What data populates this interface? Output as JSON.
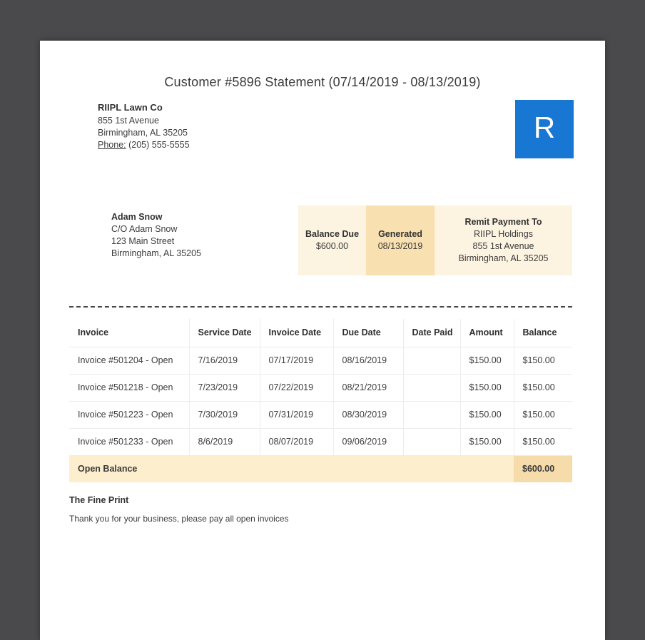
{
  "statement": {
    "title": "Customer #5896 Statement (07/14/2019 - 08/13/2019)"
  },
  "company": {
    "name": "RIIPL Lawn Co",
    "address_line1": "855 1st Avenue",
    "address_line2": "Birmingham, AL 35205",
    "phone_label": "Phone:",
    "phone": "(205) 555-5555",
    "logo_letter": "R"
  },
  "customer": {
    "name": "Adam Snow",
    "care_of": "C/O Adam Snow",
    "address_line1": "123 Main Street",
    "address_line2": "Birmingham, AL 35205"
  },
  "summary": {
    "balance_due_label": "Balance Due",
    "balance_due_amount": "$600.00",
    "generated_label": "Generated",
    "generated_date": "08/13/2019",
    "remit_label": "Remit Payment To",
    "remit_name": "RIIPL Holdings",
    "remit_address_line1": "855 1st Avenue",
    "remit_address_line2": "Birmingham, AL 35205"
  },
  "invoice_table": {
    "headers": [
      "Invoice",
      "Service Date",
      "Invoice Date",
      "Due Date",
      "Date Paid",
      "Amount",
      "Balance"
    ],
    "rows": [
      [
        "Invoice #501204 - Open",
        "7/16/2019",
        "07/17/2019",
        "08/16/2019",
        "",
        "$150.00",
        "$150.00"
      ],
      [
        "Invoice #501218 - Open",
        "7/23/2019",
        "07/22/2019",
        "08/21/2019",
        "",
        "$150.00",
        "$150.00"
      ],
      [
        "Invoice #501223 - Open",
        "7/30/2019",
        "07/31/2019",
        "08/30/2019",
        "",
        "$150.00",
        "$150.00"
      ],
      [
        "Invoice #501233 - Open",
        "8/6/2019",
        "08/07/2019",
        "09/06/2019",
        "",
        "$150.00",
        "$150.00"
      ]
    ],
    "footer": {
      "label": "Open Balance",
      "total": "$600.00"
    }
  },
  "fine_print": {
    "heading": "The Fine Print",
    "text": "Thank you for your business, please pay all open invoices"
  },
  "colors": {
    "accent_blue": "#1877d2",
    "cream_light": "#fcf3e1",
    "cream_dark": "#f8e0b0",
    "footer_row": "#fdeecd",
    "footer_total": "#f6dcaa"
  }
}
